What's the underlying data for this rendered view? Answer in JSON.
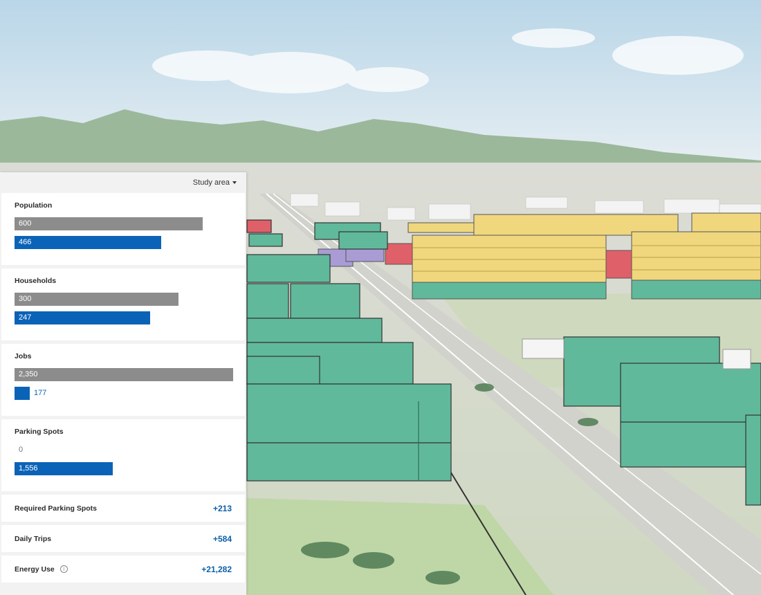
{
  "panel": {
    "area_selector": {
      "label": "Study area"
    },
    "metrics": [
      {
        "title": "Population",
        "baseline": "600",
        "baseline_fraction": 0.86,
        "scenario": "466",
        "scenario_fraction": 0.67
      },
      {
        "title": "Households",
        "baseline": "300",
        "baseline_fraction": 0.75,
        "scenario": "247",
        "scenario_fraction": 0.62
      },
      {
        "title": "Jobs",
        "baseline": "2,350",
        "baseline_fraction": 1.0,
        "scenario": "177",
        "scenario_fraction": 0.07
      },
      {
        "title": "Parking Spots",
        "baseline": "0",
        "baseline_fraction": 0.0,
        "scenario": "1,556",
        "scenario_fraction": 0.45
      }
    ],
    "stats": [
      {
        "label": "Required Parking Spots",
        "value": "+213"
      },
      {
        "label": "Daily Trips",
        "value": "+584"
      },
      {
        "label": "Energy Use",
        "value": "+21,282",
        "icon": "info-icon"
      }
    ]
  },
  "colors": {
    "baseline_bar": "#8c8c8c",
    "scenario_bar": "#0b63b8",
    "stat_value": "#0b5fa8",
    "building_green": "#5fb99a",
    "building_yellow": "#f0d77e",
    "building_red": "#e0606a",
    "building_purple": "#a99bd3"
  }
}
